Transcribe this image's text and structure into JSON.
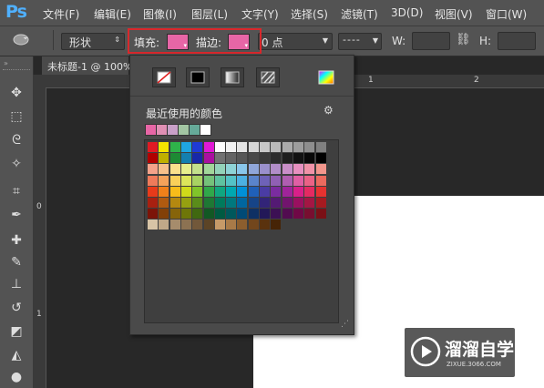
{
  "app": {
    "logo": "Ps"
  },
  "menu": [
    "文件(F)",
    "编辑(E)",
    "图像(I)",
    "图层(L)",
    "文字(Y)",
    "选择(S)",
    "滤镜(T)",
    "3D(D)",
    "视图(V)",
    "窗口(W)"
  ],
  "options_bar": {
    "shape_mode": "形状",
    "fill_label": "填充:",
    "stroke_label": "描边:",
    "stroke_width": "0 点",
    "w_label": "W:",
    "h_label": "H:",
    "fill_color": "#e766a6",
    "stroke_color": "#e766a6"
  },
  "document": {
    "tab_title": "未标题-1 @ 100%"
  },
  "rulers": {
    "top": [
      "1",
      "2"
    ],
    "left": [
      "0",
      "1"
    ]
  },
  "popup": {
    "recent_label": "最近使用的颜色",
    "recent_colors": [
      "#e766a6",
      "#e08fb4",
      "#c9a0c8",
      "#a3c6a3",
      "#66aa99",
      "#ffffff"
    ],
    "type_buttons": [
      "no-color",
      "solid",
      "gradient",
      "pattern",
      "color-picker"
    ]
  },
  "watermark": {
    "title": "溜溜自学",
    "url": "ZIXUE.3066.COM"
  },
  "tools": [
    "move-icon",
    "marquee-icon",
    "lasso-icon",
    "magic-wand-icon",
    "crop-icon",
    "eyedropper-icon",
    "healing-brush-icon",
    "brush-icon",
    "clone-stamp-icon",
    "history-brush-icon",
    "eraser-icon",
    "paint-bucket-icon",
    "dodge-icon"
  ]
}
